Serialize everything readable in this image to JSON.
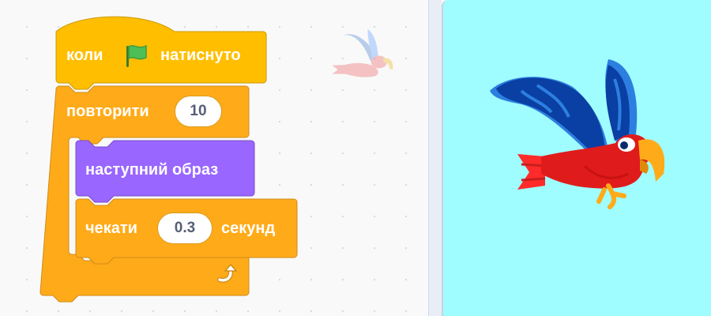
{
  "blocks": {
    "when_flag": {
      "before": "коли",
      "after": "натиснуто",
      "icon": "green-flag-icon"
    },
    "repeat": {
      "label": "повторити",
      "value": "10"
    },
    "next_costume": {
      "label": "наступний образ"
    },
    "wait": {
      "before": "чекати",
      "value": "0.3",
      "after": "секунд"
    },
    "repeat_end_icon": "loop-arrow-icon"
  },
  "colors": {
    "events": "#ffbf00",
    "control": "#ffab19",
    "looks": "#9966ff",
    "stage_background": "#9ffcff"
  },
  "sprite": {
    "name_icon": "parrot-sprite"
  }
}
